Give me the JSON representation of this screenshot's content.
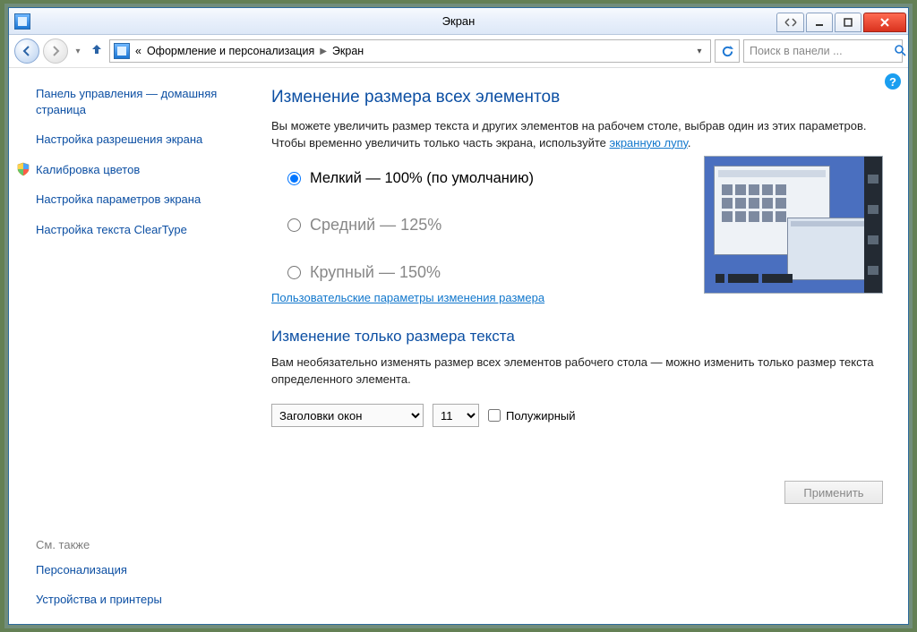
{
  "window": {
    "title": "Экран"
  },
  "breadcrumb": {
    "prefix": "«",
    "parent": "Оформление и персонализация",
    "current": "Экран"
  },
  "search": {
    "placeholder": "Поиск в панели ..."
  },
  "sidebar": {
    "home": "Панель управления — домашняя страница",
    "links": [
      "Настройка разрешения экрана",
      "Калибровка цветов",
      "Настройка параметров экрана",
      "Настройка текста ClearType"
    ],
    "seealso_label": "См. также",
    "seealso": [
      "Персонализация",
      "Устройства и принтеры"
    ]
  },
  "main": {
    "h1": "Изменение размера всех элементов",
    "intro_a": "Вы можете увеличить размер текста и других элементов на рабочем столе, выбрав один из этих параметров. Чтобы временно увеличить только часть экрана, используйте ",
    "intro_link": "экранную лупу",
    "intro_b": ".",
    "radios": [
      {
        "label": "Мелкий — 100% (по умолчанию)",
        "checked": true
      },
      {
        "label": "Средний — 125%",
        "checked": false
      },
      {
        "label": "Крупный — 150%",
        "checked": false
      }
    ],
    "custom_link": "Пользовательские параметры изменения размера",
    "h2": "Изменение только размера текста",
    "p2": "Вам необязательно изменять размер всех элементов рабочего стола — можно изменить только размер текста определенного элемента.",
    "element_select_value": "Заголовки окон",
    "size_select_value": "11",
    "bold_label": "Полужирный",
    "apply": "Применить"
  }
}
